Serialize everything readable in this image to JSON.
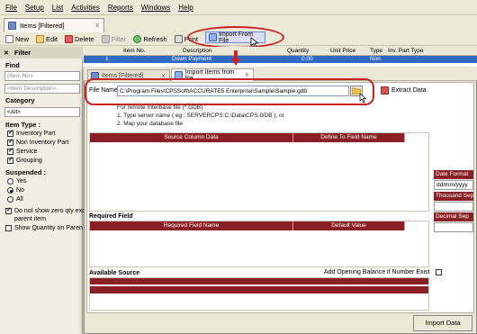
{
  "menu": [
    "File",
    "Setup",
    "List",
    "Activities",
    "Reports",
    "Windows",
    "Help"
  ],
  "items_tab": {
    "label": "Items [Filtered]",
    "close": "x"
  },
  "toolbar": {
    "new": "New",
    "edit": "Edit",
    "delete": "Delete",
    "filter": "Filter",
    "refresh": "Refresh",
    "print": "Print",
    "import": "Import From File"
  },
  "filter": {
    "title": "Filter",
    "find_label": "Find",
    "item_no_placeholder": "(Item No>",
    "item_desc_placeholder": "<Item Description>",
    "category_label": "Category",
    "category_value": "<All>",
    "item_type_label": "Item Type :",
    "item_types": [
      {
        "label": "Inventory Part",
        "checked": true
      },
      {
        "label": "Non Inventory Part",
        "checked": true
      },
      {
        "label": "Service",
        "checked": true
      },
      {
        "label": "Grouping",
        "checked": true
      }
    ],
    "suspended_label": "Suspended :",
    "suspended_options": [
      {
        "label": "Yes",
        "selected": false
      },
      {
        "label": "No",
        "selected": true
      },
      {
        "label": "All",
        "selected": false
      }
    ],
    "zero_qty_label": "Do not show zero qty exc",
    "zero_qty_label2": "parent item",
    "zero_qty_checked": true,
    "show_qty_label": "Show Quantity on Paren",
    "show_qty_checked": false
  },
  "grid": {
    "headers": {
      "item_no": "Item No.",
      "description": "Description",
      "quantity": "Quantity",
      "unit_price": "Unit Price",
      "type": "Type",
      "inv_part_type": "Inv. Part Type"
    },
    "row": {
      "item_no": "1",
      "description": "Down Payment",
      "quantity": "0.00",
      "type": "Non"
    }
  },
  "import_window": {
    "tab_back": {
      "label": "Items [Filtered]",
      "close": "x"
    },
    "tab_front": {
      "label": "Import Items from file",
      "close": "x"
    },
    "file_name_label": "File Name :",
    "file_name_value": "C:\\Program Files\\CPSSoft\\ACCURATE5 Enterprise\\Sample\\Sample.gdb",
    "extract_label": "Extract Data",
    "info_lines": [
      "For remote Interbase file (*.GDB) :",
      "1. Type server name ( eg : SERVERCPS:C:\\Data\\CPS.GDB ), or",
      "2. Map your database file"
    ],
    "source_column_header": "Source Column Data",
    "define_field_header": "Define To Field Name",
    "date_format_label": "Date Format",
    "date_format_value": "dd/mm/yyyy",
    "thousand_sep_label": "Thousand Sep",
    "decimal_sep_label": "Decimal Sep",
    "required_field_label": "Required Field",
    "required_field_header": "Required Field Name",
    "default_value_header": "Default Value",
    "available_source_label": "Available Source",
    "opening_balance_label": "Add Opening Balance if Number Exist",
    "import_button": "Import Data"
  },
  "colors": {
    "accent_red": "#8b1f26",
    "highlight_oval": "#cc2222",
    "selection_blue": "#316ac5"
  }
}
